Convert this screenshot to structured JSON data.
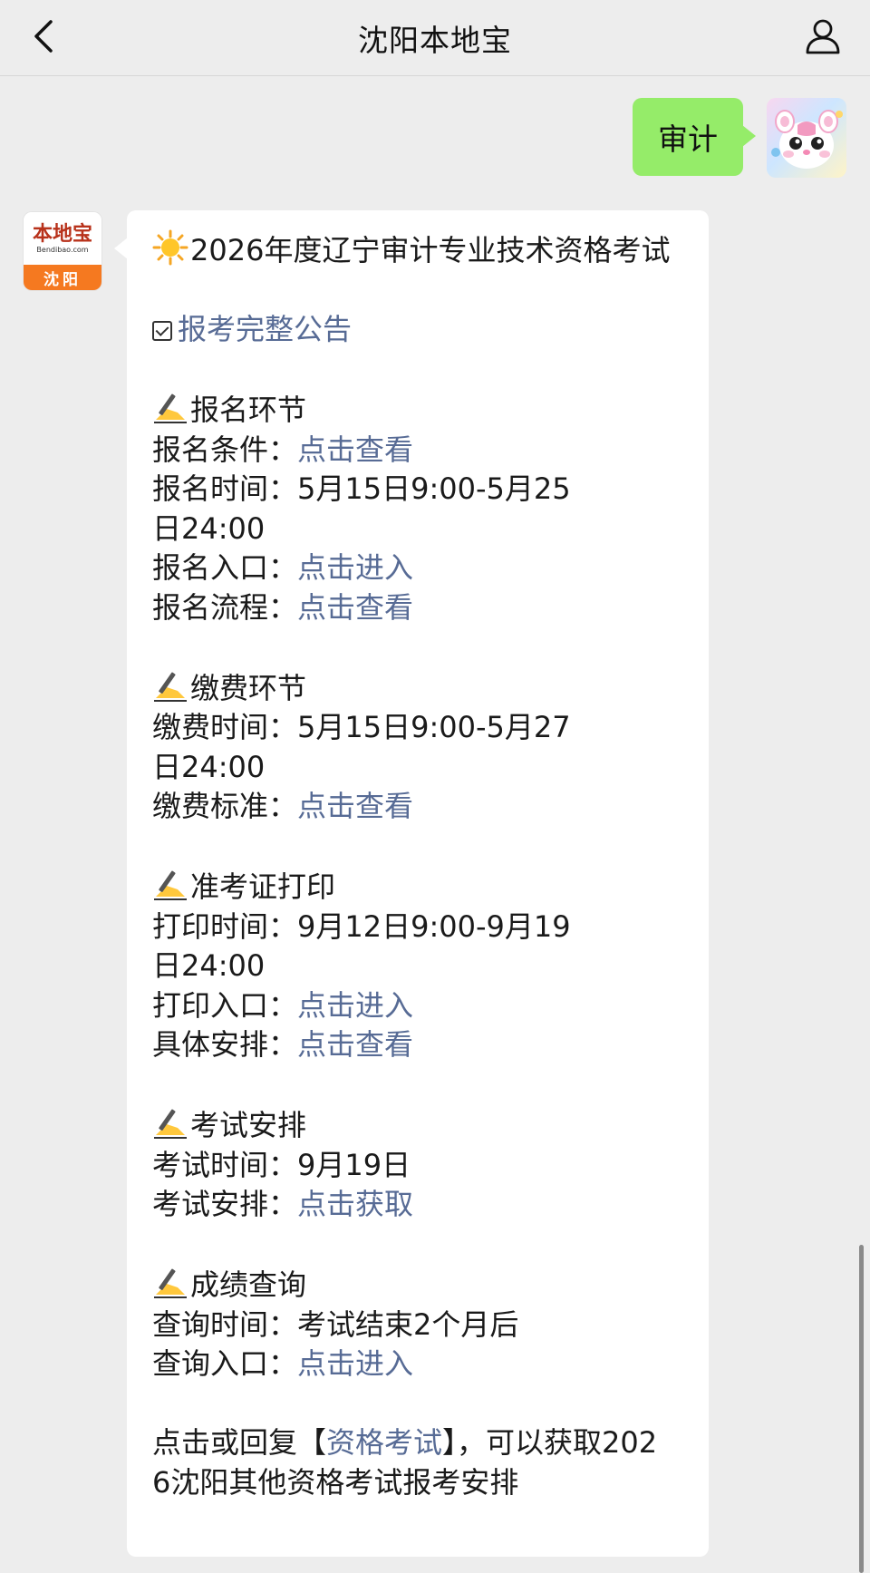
{
  "header": {
    "title": "沈阳本地宝",
    "back_icon": "chevron-left-icon",
    "profile_icon": "person-icon"
  },
  "outgoing": {
    "text": "审计",
    "bubble_color": "#95ec69"
  },
  "bot_avatar": {
    "brand": "本地宝",
    "domain": "Bendibao.com",
    "city": "沈阳",
    "accent": "#f57920"
  },
  "message": {
    "title": "2026年度辽宁审计专业技术资格考试",
    "title_icon": "sun-icon",
    "notice_link": "报考完整公告",
    "sections": {
      "signup": {
        "heading": "报名环节",
        "cond_label": "报名条件：",
        "cond_link": "点击查看",
        "time_label": "报名时间：",
        "time_value": "5月15日9:00-5月25日24:00",
        "entry_label": "报名入口：",
        "entry_link": "点击进入",
        "flow_label": "报名流程：",
        "flow_link": "点击查看"
      },
      "payment": {
        "heading": "缴费环节",
        "time_label": "缴费时间：",
        "time_value": "5月15日9:00-5月27日24:00",
        "std_label": "缴费标准：",
        "std_link": "点击查看"
      },
      "admission": {
        "heading": "准考证打印",
        "time_label": "打印时间：",
        "time_value": "9月12日9:00-9月19日24:00",
        "entry_label": "打印入口：",
        "entry_link": "点击进入",
        "plan_label": "具体安排：",
        "plan_link": "点击查看"
      },
      "exam": {
        "heading": "考试安排",
        "time_label": "考试时间：",
        "time_value": "9月19日",
        "plan_label": "考试安排：",
        "plan_link": "点击获取"
      },
      "score": {
        "heading": "成绩查询",
        "time_label": "查询时间：",
        "time_value": "考试结束2个月后",
        "entry_label": "查询入口：",
        "entry_link": "点击进入"
      }
    },
    "footer_prefix": "点击或回复【",
    "footer_link": "资格考试",
    "footer_suffix": "】，可以获取2026沈阳其他资格考试报考安排",
    "link_color": "#576b95"
  }
}
